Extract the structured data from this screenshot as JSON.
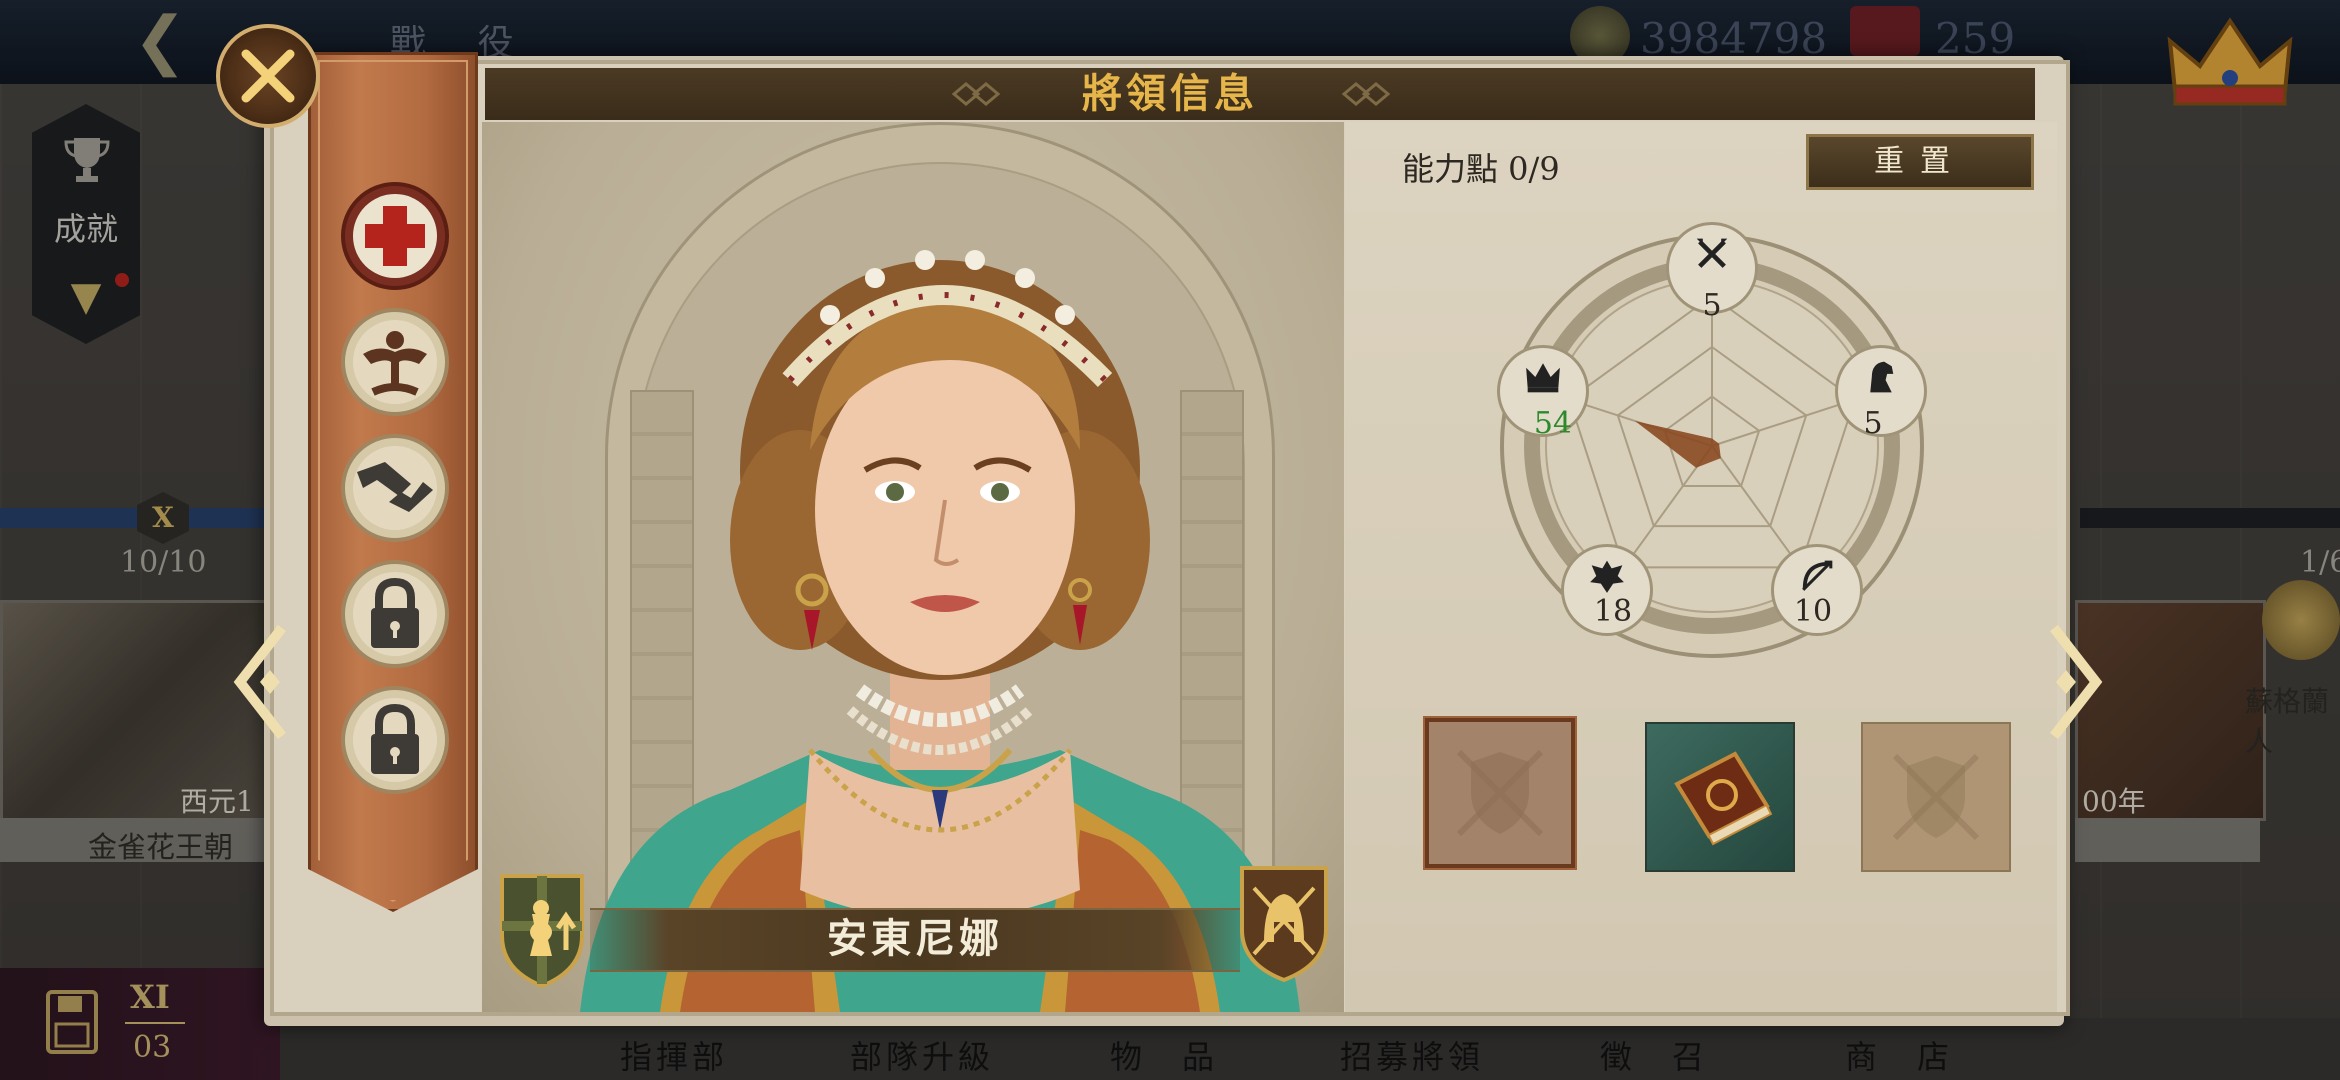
{
  "background": {
    "top_title": "戰 役",
    "gold_amount": "3984798",
    "second_amount": "259",
    "achievement_label": "成就",
    "era_roman": "X",
    "era_progress": "10/10",
    "era_year": "西元1",
    "era_name": "金雀花王朝",
    "right_progress": "1/6",
    "right_year": "00年",
    "right_emblem_name": "蘇格蘭人",
    "save_roman": "XI",
    "save_number": "03",
    "bottom_nav": [
      "指揮部",
      "部隊升級",
      "物　品",
      "招募將領",
      "徵　召",
      "商　店"
    ]
  },
  "dialog": {
    "title": "將領信息",
    "general_name": "安東尼娜",
    "ability_points_label": "能力點 0/9",
    "reset_label": "重置",
    "stats": {
      "attack": {
        "icon": "crossed-swords-icon",
        "value": 5
      },
      "cavalry": {
        "icon": "knight-horse-icon",
        "value": 5
      },
      "archery": {
        "icon": "bow-icon",
        "value": 10
      },
      "defense": {
        "icon": "eagle-icon",
        "value": 18
      },
      "leadership": {
        "icon": "crown-icon",
        "value": 54
      }
    },
    "skills": [
      {
        "icon": "medic-cross-icon",
        "state": "unlocked"
      },
      {
        "icon": "strongman-icon",
        "state": "unlocked"
      },
      {
        "icon": "handshake-icon",
        "state": "unlocked"
      },
      {
        "icon": "padlock-icon",
        "state": "locked"
      },
      {
        "icon": "padlock-icon",
        "state": "locked"
      }
    ],
    "item_slots": [
      {
        "icon": "shield-swords-icon",
        "state": "selected-empty"
      },
      {
        "icon": "book-icon",
        "state": "equipped"
      },
      {
        "icon": "shield-swords-icon",
        "state": "empty"
      }
    ]
  },
  "colors": {
    "title_gold": "#e7b64a",
    "leadership_value": "#2c8a2c",
    "panel_paper": "#d9d0bd",
    "sidebar_copper": "#b26a40"
  }
}
